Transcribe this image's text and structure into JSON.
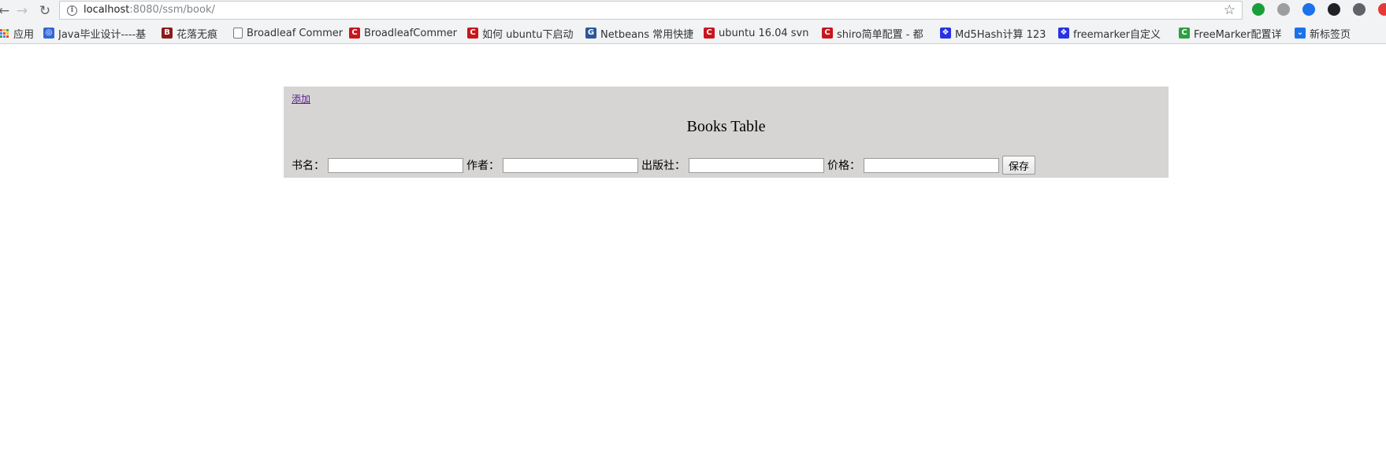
{
  "browser": {
    "url_host": "localhost",
    "url_rest": ":8080/ssm/book/",
    "nav": {
      "back": "←",
      "forward": "→",
      "reload": "↻"
    },
    "star": "☆",
    "extensions": [
      {
        "name": "shield-ext-icon",
        "color": "#1a9e3a"
      },
      {
        "name": "circle-ext-icon",
        "color": "#9e9e9e"
      },
      {
        "name": "pocket-ext-icon",
        "color": "#1a73e8"
      },
      {
        "name": "dark-ext-icon",
        "color": "#202124"
      },
      {
        "name": "bulb-ext-icon",
        "color": "#5f6368"
      },
      {
        "name": "record-ext-icon",
        "color": "#e53935"
      }
    ]
  },
  "bookmarks": [
    {
      "label": "应用",
      "icon": "apps-grid-icon",
      "color": ""
    },
    {
      "label": "Java毕业设计----基",
      "icon": "globe-icon",
      "color": "#3367d6"
    },
    {
      "label": "花落无痕",
      "icon": "b-icon",
      "color": "#8b1b1b"
    },
    {
      "label": "Broadleaf Commer",
      "icon": "page-icon",
      "color": ""
    },
    {
      "label": "BroadleafCommer",
      "icon": "csdn-icon",
      "color": "#c8161d"
    },
    {
      "label": "如何 ubuntu下启动",
      "icon": "csdn-icon",
      "color": "#c8161d"
    },
    {
      "label": "Netbeans 常用快捷",
      "icon": "g-icon",
      "color": "#2b579a"
    },
    {
      "label": "ubuntu 16.04 svn",
      "icon": "csdn-icon",
      "color": "#c8161d"
    },
    {
      "label": "shiro简单配置 - 都",
      "icon": "csdn-icon",
      "color": "#c8161d"
    },
    {
      "label": "Md5Hash计算 123",
      "icon": "paw-icon",
      "color": "#2932e1"
    },
    {
      "label": "freemarker自定义",
      "icon": "paw-icon",
      "color": "#2932e1"
    },
    {
      "label": "FreeMarker配置详",
      "icon": "c-green-icon",
      "color": "#2e9e44"
    },
    {
      "label": "新标签页",
      "icon": "pocket-icon",
      "color": "#1a73e8"
    }
  ],
  "page": {
    "add_link": "添加",
    "title": "Books Table",
    "fields": [
      {
        "label": "书名：",
        "name": "book-name-input"
      },
      {
        "label": "作者：",
        "name": "author-input"
      },
      {
        "label": "出版社：",
        "name": "publisher-input"
      },
      {
        "label": "价格：",
        "name": "price-input"
      }
    ],
    "save_label": "保存"
  }
}
